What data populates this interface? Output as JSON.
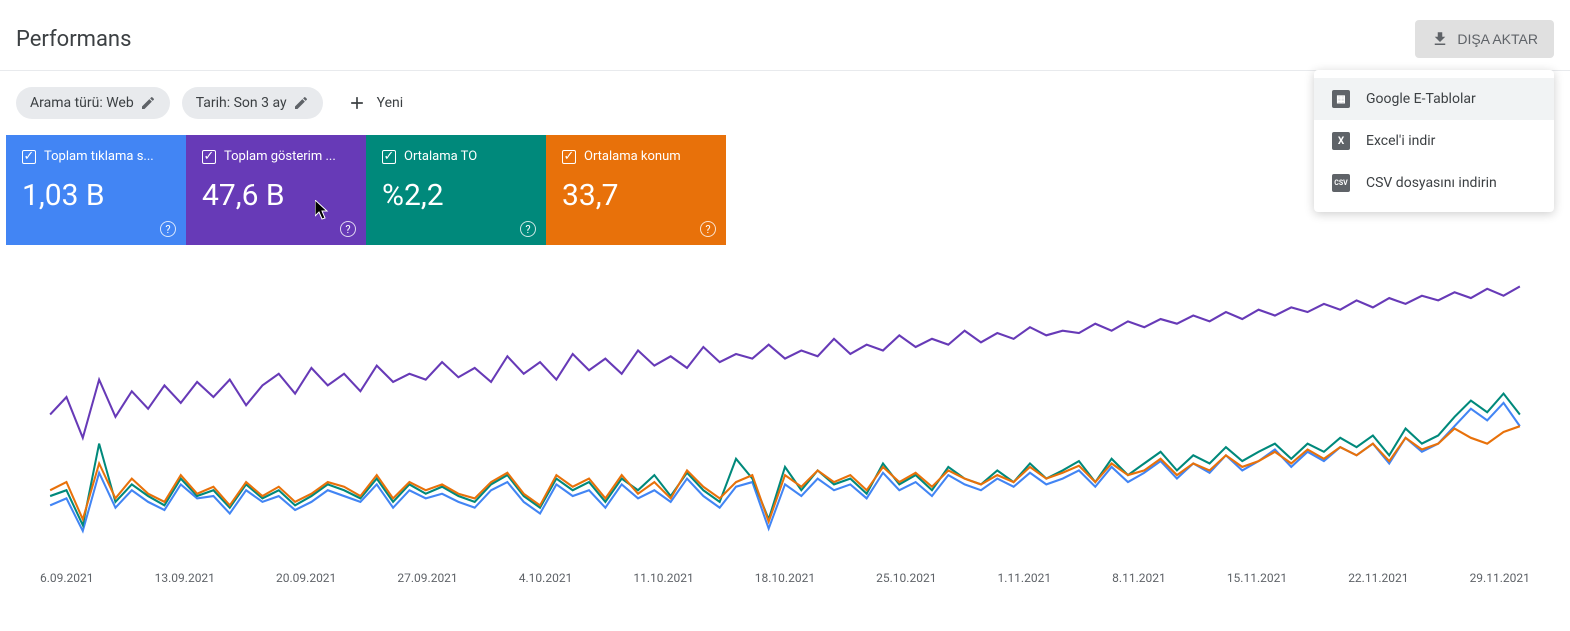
{
  "header": {
    "title": "Performans",
    "export_label": "DIŞA AKTAR"
  },
  "filters": {
    "search_type": "Arama türü: Web",
    "date_range": "Tarih: Son 3 ay",
    "new_label": "Yeni"
  },
  "metrics": {
    "clicks": {
      "label": "Toplam tıklama s...",
      "value": "1,03 B"
    },
    "impressions": {
      "label": "Toplam gösterim ...",
      "value": "47,6 B"
    },
    "ctr": {
      "label": "Ortalama TO",
      "value": "%2,2"
    },
    "position": {
      "label": "Ortalama konum",
      "value": "33,7"
    }
  },
  "export_menu": {
    "sheets": "Google E-Tablolar",
    "excel": "Excel'i indir",
    "csv": "CSV dosyasını indirin"
  },
  "chart_data": {
    "type": "line",
    "xlabel": "",
    "ylabel": "",
    "categories": [
      "6.09.2021",
      "13.09.2021",
      "20.09.2021",
      "27.09.2021",
      "4.10.2021",
      "11.10.2021",
      "18.10.2021",
      "25.10.2021",
      "1.11.2021",
      "8.11.2021",
      "15.11.2021",
      "22.11.2021",
      "29.11.2021"
    ],
    "series": [
      {
        "name": "clicks",
        "color": "#4285f4",
        "values": [
          42,
          48,
          20,
          70,
          40,
          55,
          45,
          38,
          60,
          48,
          50,
          35,
          55,
          45,
          50,
          38,
          45,
          55,
          50,
          45,
          60,
          40,
          55,
          48,
          52,
          45,
          40,
          55,
          62,
          45,
          35,
          60,
          50,
          55,
          40,
          60,
          48,
          55,
          45,
          65,
          50,
          40,
          58,
          62,
          22,
          60,
          50,
          65,
          55,
          60,
          48,
          70,
          55,
          62,
          50,
          68,
          60,
          55,
          65,
          58,
          70,
          60,
          65,
          72,
          58,
          75,
          62,
          70,
          80,
          65,
          78,
          70,
          85,
          72,
          80,
          90,
          75,
          88,
          80,
          92,
          85,
          95,
          78,
          100,
          88,
          95,
          110,
          125,
          115,
          130,
          110
        ]
      },
      {
        "name": "impressions",
        "color": "#673ab7",
        "values": [
          120,
          135,
          100,
          150,
          118,
          140,
          125,
          145,
          130,
          148,
          135,
          150,
          128,
          145,
          155,
          138,
          160,
          145,
          155,
          140,
          162,
          148,
          155,
          150,
          165,
          152,
          160,
          148,
          170,
          155,
          165,
          150,
          172,
          158,
          168,
          155,
          175,
          162,
          170,
          160,
          178,
          165,
          172,
          168,
          180,
          168,
          175,
          170,
          185,
          172,
          180,
          175,
          188,
          178,
          185,
          180,
          192,
          182,
          190,
          185,
          195,
          188,
          192,
          190,
          198,
          192,
          200,
          195,
          202,
          198,
          205,
          200,
          208,
          202,
          210,
          205,
          212,
          208,
          215,
          210,
          218,
          212,
          220,
          215,
          222,
          218,
          225,
          220,
          228,
          222,
          230
        ]
      },
      {
        "name": "ctr",
        "color": "#00897b",
        "values": [
          50,
          55,
          25,
          95,
          45,
          60,
          50,
          42,
          65,
          50,
          55,
          40,
          60,
          48,
          55,
          42,
          50,
          60,
          55,
          48,
          65,
          45,
          60,
          52,
          58,
          50,
          45,
          60,
          68,
          50,
          40,
          65,
          55,
          62,
          45,
          65,
          55,
          68,
          50,
          70,
          55,
          45,
          82,
          65,
          30,
          75,
          55,
          72,
          60,
          65,
          52,
          78,
          60,
          68,
          55,
          75,
          65,
          60,
          72,
          62,
          78,
          65,
          72,
          80,
          62,
          82,
          68,
          78,
          88,
          72,
          85,
          78,
          92,
          80,
          88,
          95,
          82,
          95,
          88,
          100,
          92,
          102,
          85,
          108,
          95,
          102,
          118,
          132,
          122,
          138,
          120
        ]
      },
      {
        "name": "position",
        "color": "#e8710a",
        "values": [
          55,
          62,
          30,
          78,
          48,
          65,
          52,
          45,
          68,
          52,
          58,
          42,
          62,
          50,
          58,
          45,
          52,
          62,
          58,
          50,
          68,
          48,
          62,
          55,
          60,
          52,
          48,
          62,
          70,
          52,
          42,
          68,
          58,
          65,
          48,
          68,
          52,
          62,
          48,
          72,
          58,
          48,
          62,
          68,
          28,
          68,
          58,
          72,
          62,
          68,
          55,
          75,
          62,
          70,
          58,
          72,
          65,
          60,
          68,
          62,
          75,
          65,
          70,
          76,
          62,
          78,
          68,
          72,
          82,
          68,
          78,
          72,
          85,
          75,
          80,
          88,
          78,
          90,
          82,
          92,
          85,
          95,
          80,
          100,
          90,
          95,
          108,
          100,
          95,
          105,
          110
        ]
      }
    ]
  }
}
